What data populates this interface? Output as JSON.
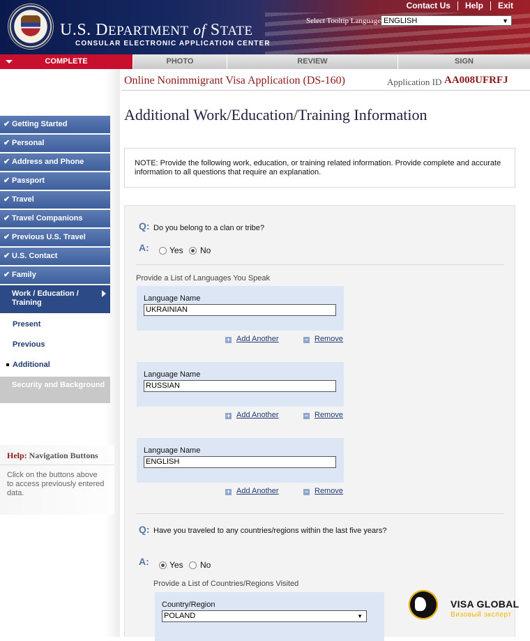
{
  "header": {
    "dept_title_a": "U.S. D",
    "dept_title_b": "EPARTMENT",
    "dept_title_of": "of",
    "dept_title_c": "S",
    "dept_title_d": "TATE",
    "dept_subtitle": "CONSULAR ELECTRONIC APPLICATION CENTER",
    "links": [
      "Contact Us",
      "Help",
      "Exit"
    ],
    "tooltip_label": "Select Tooltip Language",
    "tooltip_value": "ENGLISH"
  },
  "steps": [
    "COMPLETE",
    "PHOTO",
    "REVIEW",
    "SIGN"
  ],
  "form": {
    "title": "Online Nonimmigrant Visa Application (DS-160)",
    "app_id_label": "Application ID",
    "app_id_value": "AA008UFRFJ",
    "page_title": "Additional Work/Education/Training Information"
  },
  "sidebar": {
    "items": [
      "Getting Started",
      "Personal",
      "Address and Phone",
      "Passport",
      "Travel",
      "Travel Companions",
      "Previous U.S. Travel",
      "U.S. Contact",
      "Family"
    ],
    "current": "Work / Education / Training",
    "subitems": [
      "Present",
      "Previous",
      "Additional"
    ],
    "disabled": "Security and Background",
    "check": "✔"
  },
  "help": {
    "prefix": "Help:",
    "topic": "Navigation Buttons",
    "text": "Click on the buttons above to access previously entered data."
  },
  "note": "NOTE: Provide the following work, education, or training related information. Provide complete and accurate information to all questions that require an explanation.",
  "q_mark": "Q:",
  "a_mark": "A:",
  "q1": {
    "text": "Do you belong to a clan or tribe?",
    "yes": "Yes",
    "no": "No",
    "selected": "No"
  },
  "languages": {
    "label": "Provide a List of Languages You Speak",
    "field_label": "Language Name",
    "values": [
      "UKRAINIAN",
      "RUSSIAN",
      "ENGLISH"
    ],
    "add": "Add Another",
    "remove": "Remove"
  },
  "q2": {
    "text": "Have you traveled to any countries/regions within the last five years?",
    "yes": "Yes",
    "no": "No",
    "selected": "Yes",
    "list_label": "Provide a List of Countries/Regions Visited",
    "field_label": "Country/Region",
    "value": "POLAND"
  },
  "watermark": {
    "title": "VISA GLOBAL",
    "subtitle": "Визовый эксперт"
  },
  "colors": {
    "accent_red": "#c8102e",
    "nav_blue": "#3e5f9c",
    "title_red": "#8b1a1a"
  }
}
